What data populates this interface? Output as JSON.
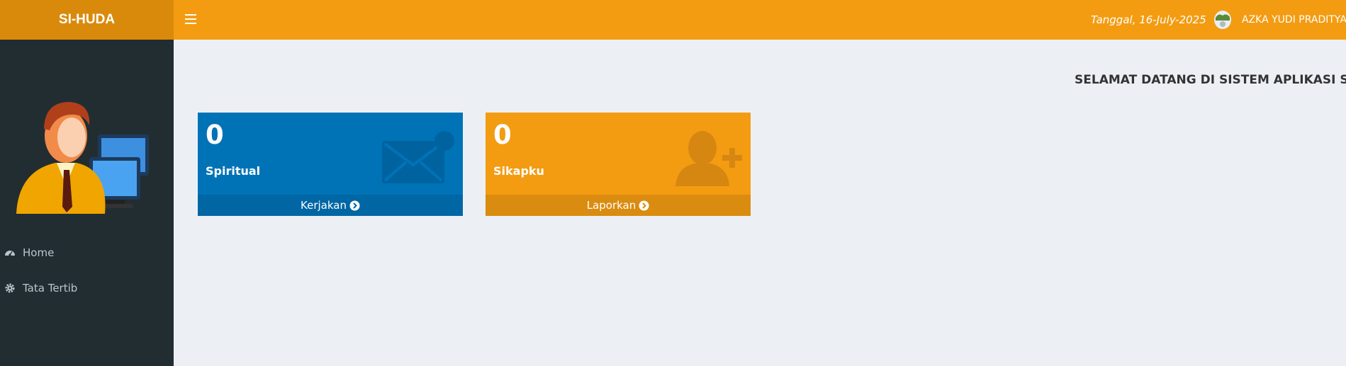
{
  "app": {
    "logo_text": "SI-HUDA"
  },
  "header": {
    "date_text": "Tanggal, 16-July-2025",
    "user_name": "AZKA YUDI PRADITYA",
    "accent_color": "#f39c12"
  },
  "sidebar": {
    "items": [
      {
        "label": "Home",
        "icon": "dashboard-icon"
      },
      {
        "label": "Tata Tertib",
        "icon": "gear-icon"
      }
    ]
  },
  "main": {
    "welcome_text": "SELAMAT DATANG DI SISTEM APLIKASI SIKAPKU",
    "boxes": [
      {
        "count": "0",
        "title": "Spiritual",
        "footer": "Kerjakan",
        "icon": "envelope-icon",
        "color": "#0073b7"
      },
      {
        "count": "0",
        "title": "Sikapku",
        "footer": "Laporkan",
        "icon": "user-plus-icon",
        "color": "#f39c12"
      }
    ]
  }
}
